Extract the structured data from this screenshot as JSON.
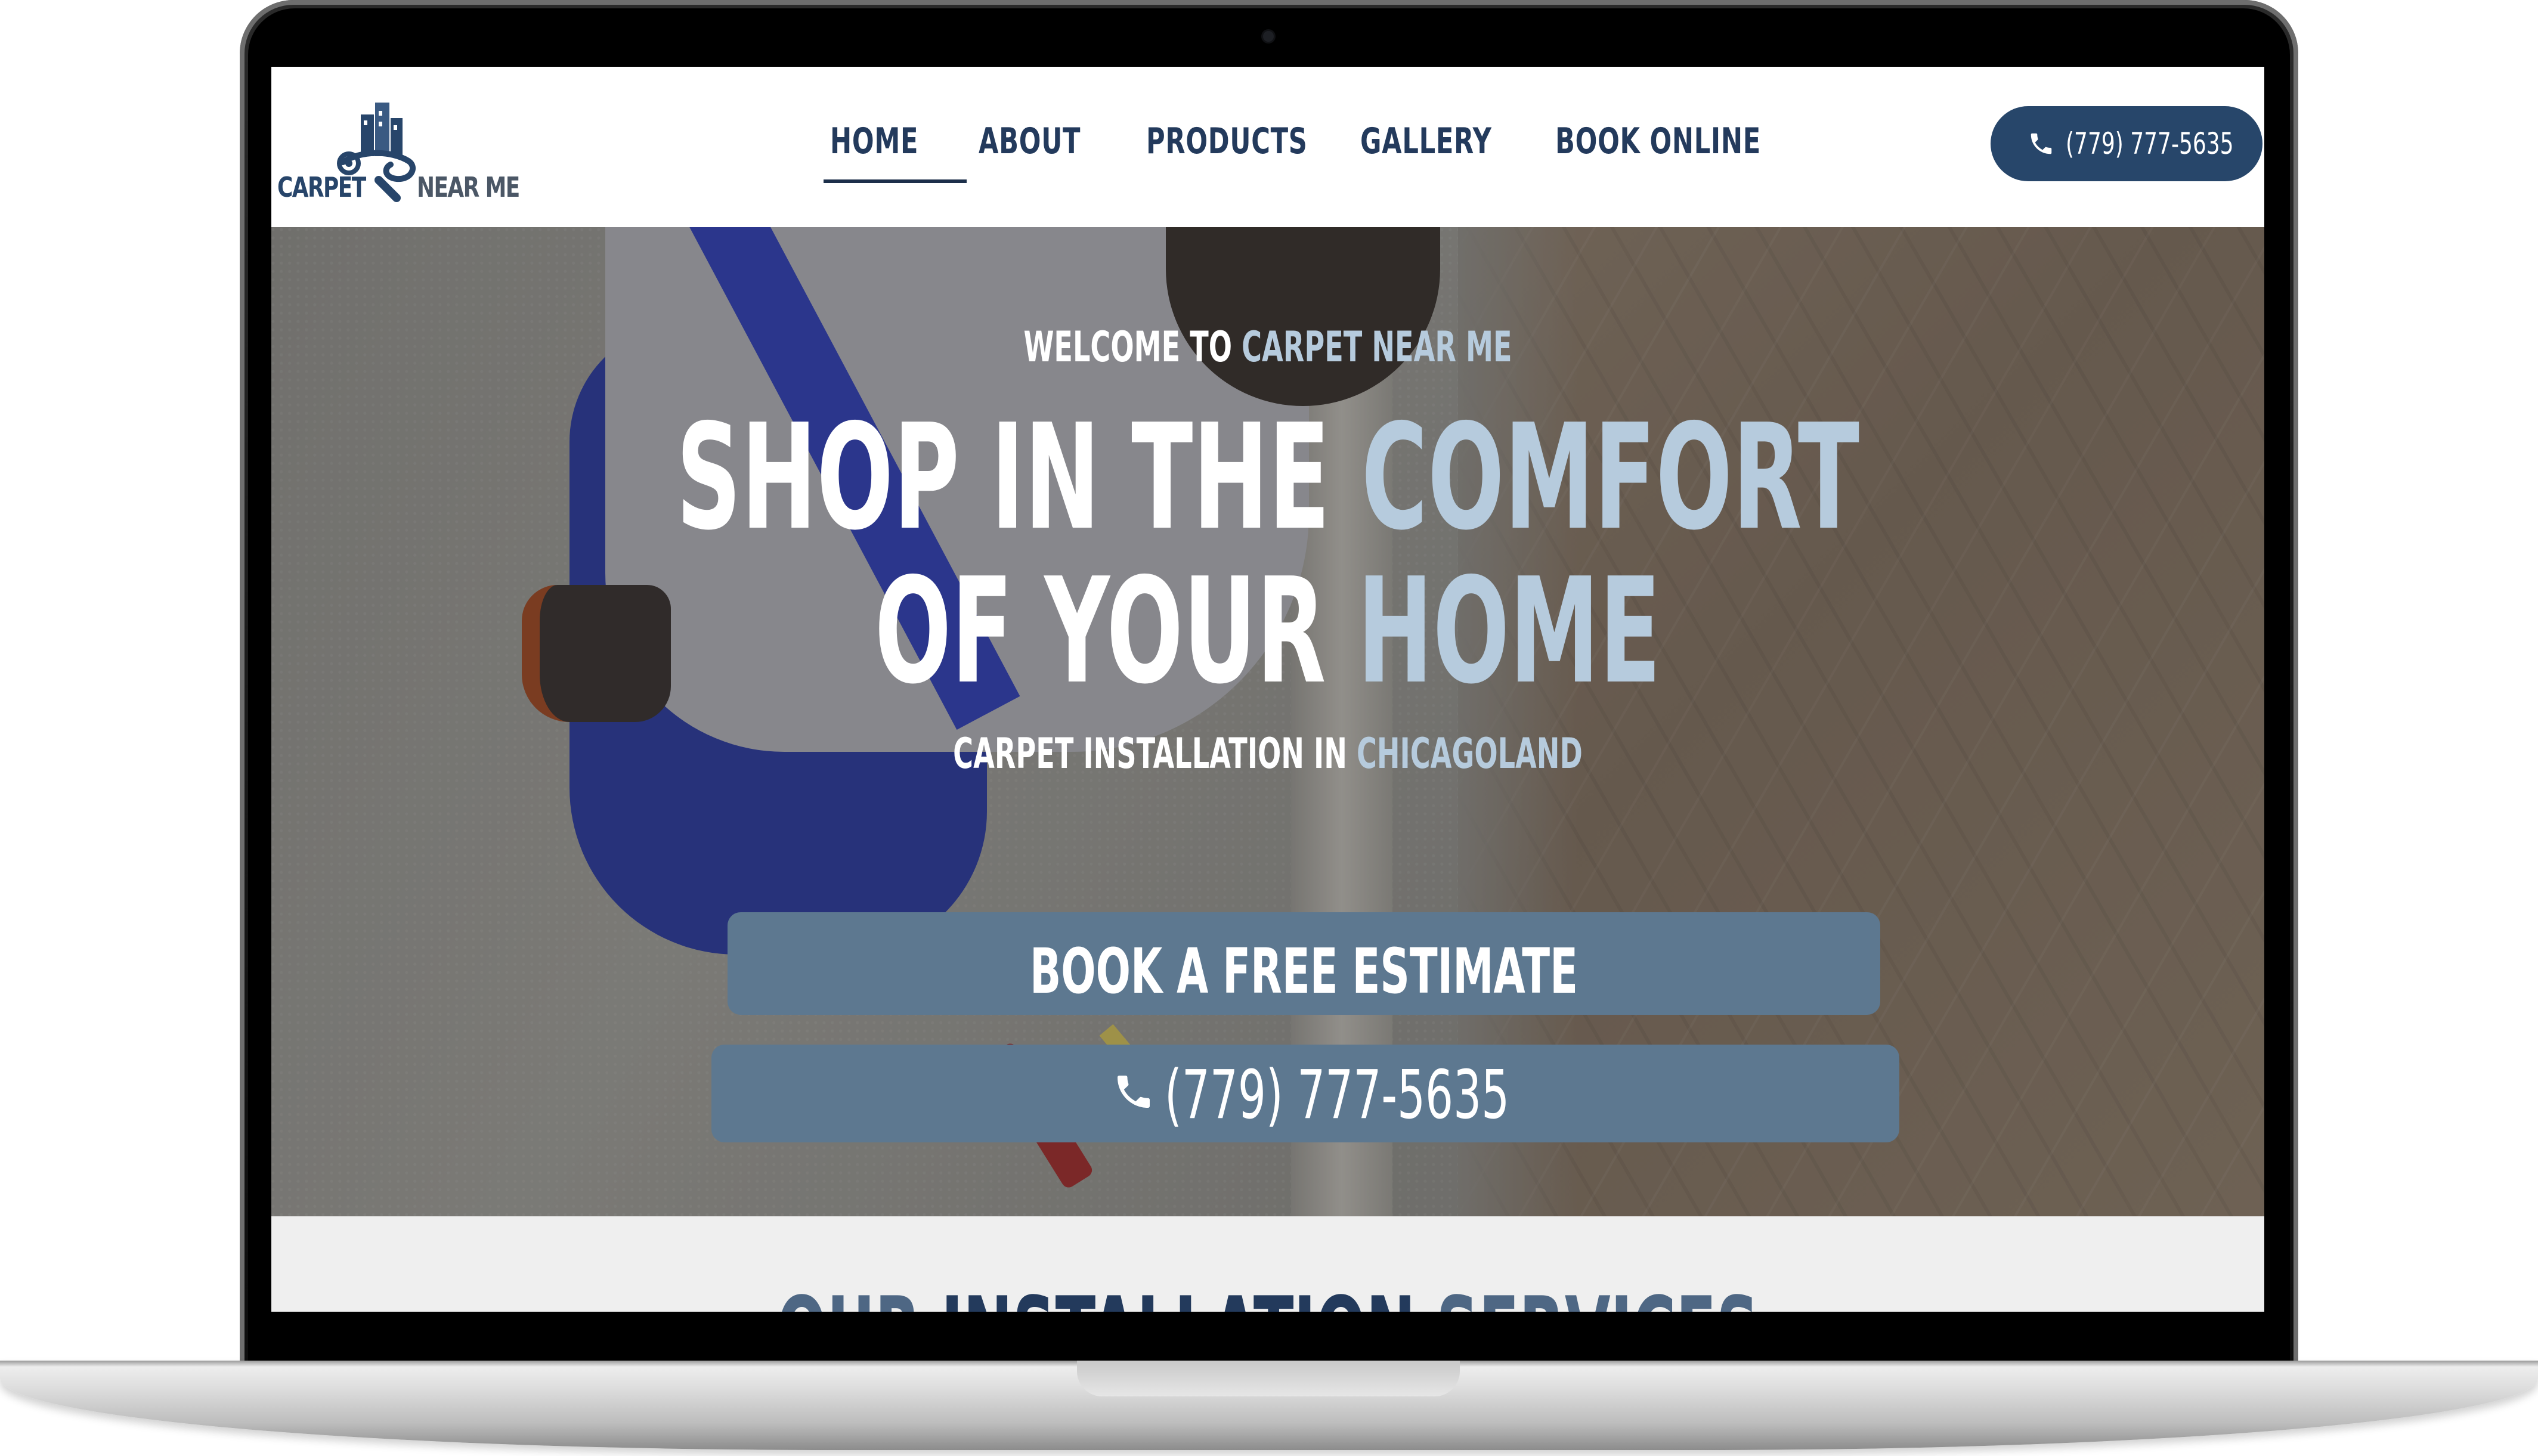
{
  "brand": {
    "logo_left": "CARPET",
    "logo_right": "NEAR ME",
    "colors": {
      "navy": "#233a5c",
      "button_navy": "#27466a",
      "cta_blue": "#5d7890",
      "accent": "#b6cbdd"
    }
  },
  "nav": {
    "items": [
      {
        "label": "HOME",
        "active": true
      },
      {
        "label": "ABOUT"
      },
      {
        "label": "PRODUCTS"
      },
      {
        "label": "GALLERY"
      },
      {
        "label": "BOOK ONLINE"
      }
    ],
    "phone": "(779) 777-5635",
    "phone_icon": "phone-icon"
  },
  "hero": {
    "welcome_prefix": "WELCOME TO ",
    "welcome_accent": "CARPET NEAR ME",
    "headline_line1_prefix": "SHOP IN THE ",
    "headline_line1_accent": "COMFORT",
    "headline_line2_prefix": "OF YOUR ",
    "headline_line2_accent": "HOME",
    "sub_prefix": "CARPET INSTALLATION IN ",
    "sub_accent": "CHICAGOLAND",
    "cta_estimate": "BOOK A FREE ESTIMATE",
    "cta_phone": "(779) 777-5635"
  },
  "services": {
    "title_part1": "OUR ",
    "title_part2": "INSTALLATION ",
    "title_part3": "SERVICES"
  }
}
